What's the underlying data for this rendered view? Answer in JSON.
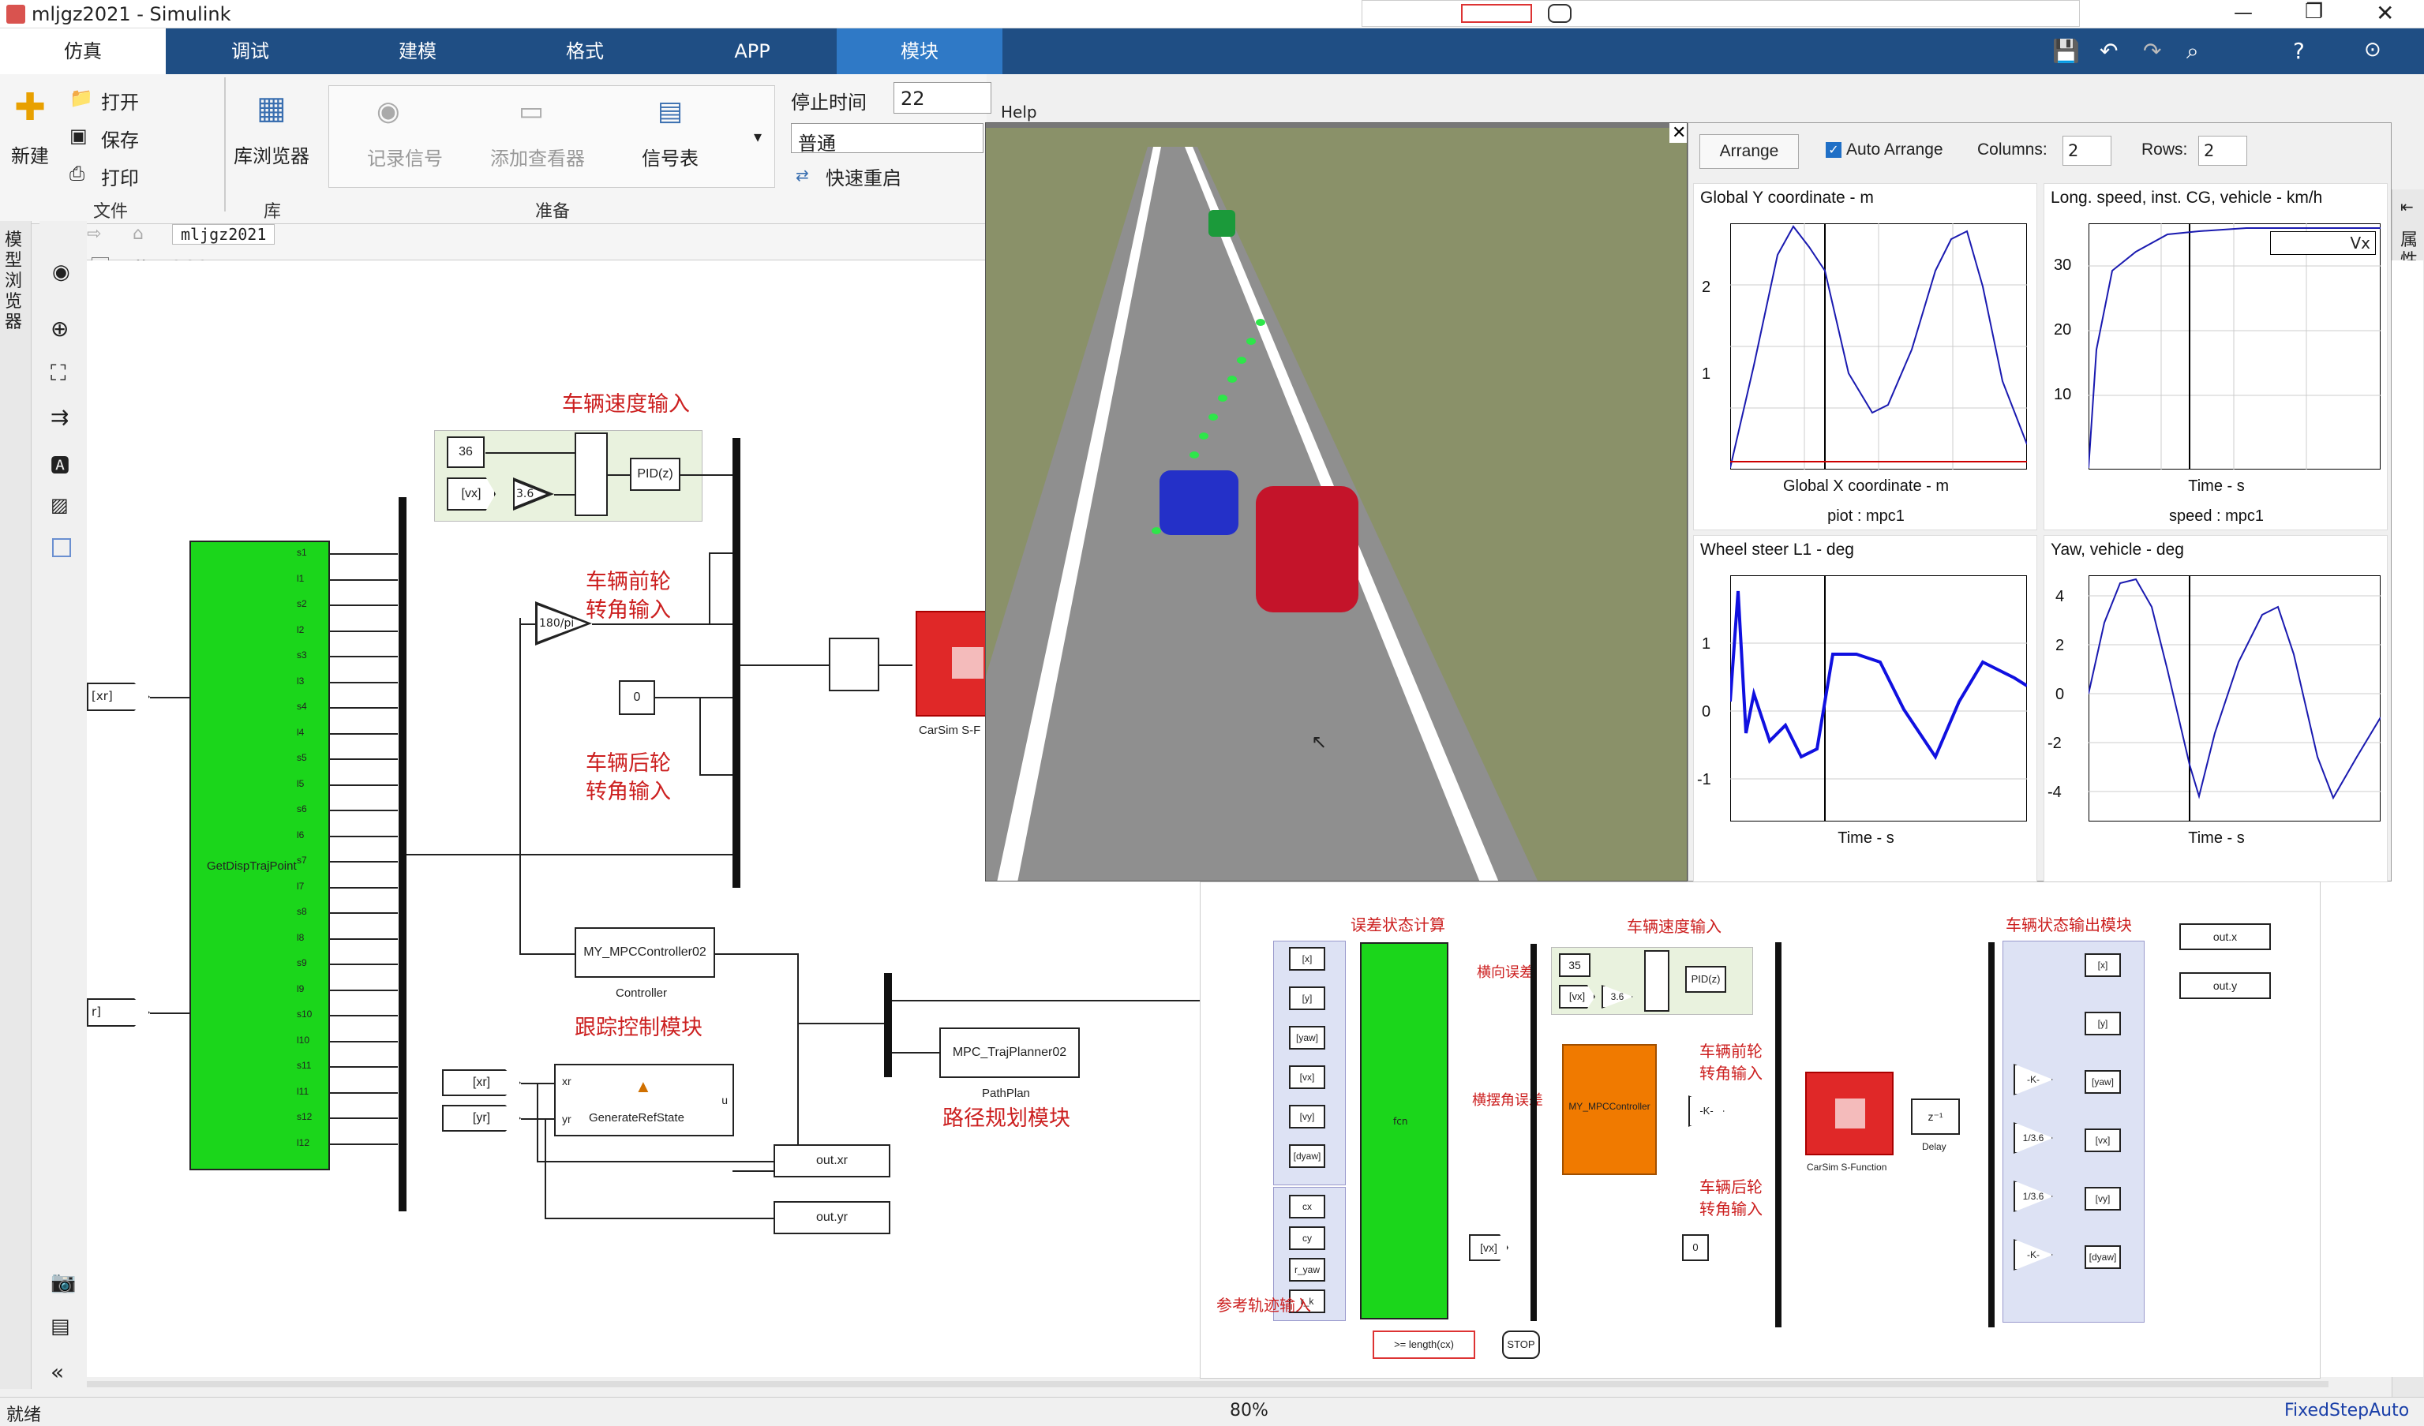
{
  "window": {
    "title": "mljgz2021 - Simulink"
  },
  "tabs": [
    "仿真",
    "调试",
    "建模",
    "格式",
    "APP",
    "模块"
  ],
  "ribbon": {
    "new": "新建",
    "open": "打开",
    "save": "保存",
    "print": "打印",
    "file_group": "文件",
    "library_browser": "库浏览器",
    "library_group": "库",
    "log_signals": "记录信号",
    "add_viewer": "添加查看器",
    "signal_table": "信号表",
    "prepare_group": "准备",
    "stop_time_label": "停止时间",
    "stop_time_value": "22",
    "mode_value": "普通",
    "fast_restart": "快速重启",
    "help": "Help"
  },
  "breadcrumb": {
    "tab": "mljgz2021",
    "path": "mljgz2021"
  },
  "left_panel_label": "模型浏览器",
  "right_panel_label": "属性检查器",
  "main_diagram": {
    "labels": {
      "veh_speed_input": "车辆速度输入",
      "front_wheel_input": "车辆前轮\n转角输入",
      "rear_wheel_input": "车辆后轮\n转角输入",
      "tracking_module": "跟踪控制模块",
      "path_planning_module": "路径规划模块"
    },
    "blocks": {
      "const36": "36",
      "vx": "[vx]",
      "gain36": "3.6",
      "pid": "PID(z)",
      "gain_rad": "180/pi",
      "const0": "0",
      "get_traj": "GetDispTrajPoint",
      "carsim": "CarSim S-F",
      "mpc": "MY_MPCController02",
      "mpc_sub": "Controller",
      "planner": "MPC_TrajPlanner02",
      "planner_sub": "PathPlan",
      "genref": "GenerateRefState",
      "xr": "[xr]",
      "yr": "[yr]",
      "xr_in": "[xr]",
      "yr_in": "r]",
      "outxr": "out.xr",
      "outyr": "out.yr",
      "genref_u": "u",
      "genref_xr": "xr",
      "genref_yr": "yr"
    },
    "ports": [
      "s1",
      "l1",
      "s2",
      "l2",
      "s3",
      "l3",
      "s4",
      "l4",
      "s5",
      "l5",
      "s6",
      "l6",
      "s7",
      "l7",
      "s8",
      "l8",
      "s9",
      "l9",
      "s10",
      "l10",
      "s11",
      "l11",
      "s12",
      "l12"
    ]
  },
  "plot_window": {
    "arrange": "Arrange",
    "auto_arrange": "Auto Arrange",
    "columns_label": "Columns:",
    "columns": "2",
    "rows_label": "Rows:",
    "rows": "2",
    "panels": [
      {
        "title": "Global Y coordinate - m",
        "xlabel": "Global X coordinate - m",
        "caption": "piot : mpc1",
        "yticks": [
          "2",
          "1"
        ]
      },
      {
        "title": "Long. speed, inst. CG, vehicle - km/h",
        "xlabel": "Time - s",
        "caption": "speed : mpc1",
        "yticks": [
          "30",
          "20",
          "10"
        ],
        "legend": "Vx"
      },
      {
        "title": "Wheel steer L1 - deg",
        "xlabel": "Time - s",
        "yticks": [
          "1",
          "0",
          "-1"
        ]
      },
      {
        "title": "Yaw, vehicle - deg",
        "xlabel": "Time - s",
        "yticks": [
          "4",
          "2",
          "0",
          "-2",
          "-4"
        ]
      }
    ]
  },
  "sub_diagram": {
    "labels": {
      "err_calc": "误差状态计算",
      "veh_speed": "车辆速度输入",
      "lat_err": "横向误差",
      "yaw_err": "横摆角误差",
      "front": "车辆前轮\n转角输入",
      "rear": "车辆后轮\n转角输入",
      "ref_traj": "参考轨迹输入",
      "state_out": "车辆状态输出模块"
    },
    "inputs": [
      "[x]",
      "[y]",
      "[yaw]",
      "[vx]",
      "[vy]",
      "[dyaw]"
    ],
    "refs": [
      "cx",
      "cy",
      "r_yaw",
      "r_k"
    ],
    "blocks": {
      "const35": "35",
      "vx": "[vx]",
      "g36": "3.6",
      "pid": "PID(z)",
      "mpc": "MY_MPCController",
      "k": "-K-",
      "const0": "0",
      "carsim": "CarSim S-Function",
      "delay": "z⁻¹",
      "delay_label": "Delay",
      "stop_cmp": ">= length(cx)",
      "stop": "STOP",
      "fcn": "fcn",
      "vx2": "[vx]"
    },
    "outs": [
      "out.x",
      "out.y"
    ],
    "states": [
      "[x]",
      "[y]",
      "[yaw]",
      "[vx]",
      "[vy]",
      "[dyaw]"
    ],
    "gains": [
      "-K-",
      "1/3.6",
      "1/3.6",
      "-K-"
    ]
  },
  "status": {
    "left": "就绪",
    "zoom": "80%",
    "solver": "FixedStepAuto"
  }
}
